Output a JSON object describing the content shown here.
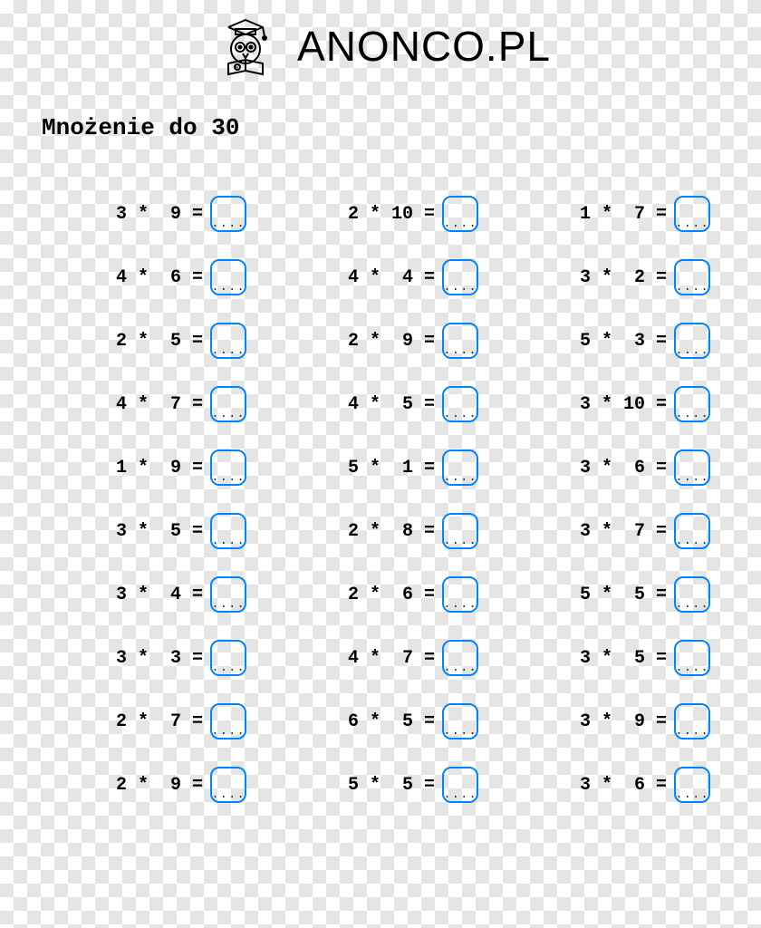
{
  "brand": "ANONCO.PL",
  "title": "Mnożenie do 30",
  "placeholder": "....",
  "columns": [
    [
      {
        "a": 3,
        "b": 9
      },
      {
        "a": 4,
        "b": 6
      },
      {
        "a": 2,
        "b": 5
      },
      {
        "a": 4,
        "b": 7
      },
      {
        "a": 1,
        "b": 9
      },
      {
        "a": 3,
        "b": 5
      },
      {
        "a": 3,
        "b": 4
      },
      {
        "a": 3,
        "b": 3
      },
      {
        "a": 2,
        "b": 7
      },
      {
        "a": 2,
        "b": 9
      }
    ],
    [
      {
        "a": 2,
        "b": 10
      },
      {
        "a": 4,
        "b": 4
      },
      {
        "a": 2,
        "b": 9
      },
      {
        "a": 4,
        "b": 5
      },
      {
        "a": 5,
        "b": 1
      },
      {
        "a": 2,
        "b": 8
      },
      {
        "a": 2,
        "b": 6
      },
      {
        "a": 4,
        "b": 7
      },
      {
        "a": 6,
        "b": 5
      },
      {
        "a": 5,
        "b": 5
      }
    ],
    [
      {
        "a": 1,
        "b": 7
      },
      {
        "a": 3,
        "b": 2
      },
      {
        "a": 5,
        "b": 3
      },
      {
        "a": 3,
        "b": 10
      },
      {
        "a": 3,
        "b": 6
      },
      {
        "a": 3,
        "b": 7
      },
      {
        "a": 5,
        "b": 5
      },
      {
        "a": 3,
        "b": 5
      },
      {
        "a": 3,
        "b": 9
      },
      {
        "a": 3,
        "b": 6
      }
    ]
  ]
}
